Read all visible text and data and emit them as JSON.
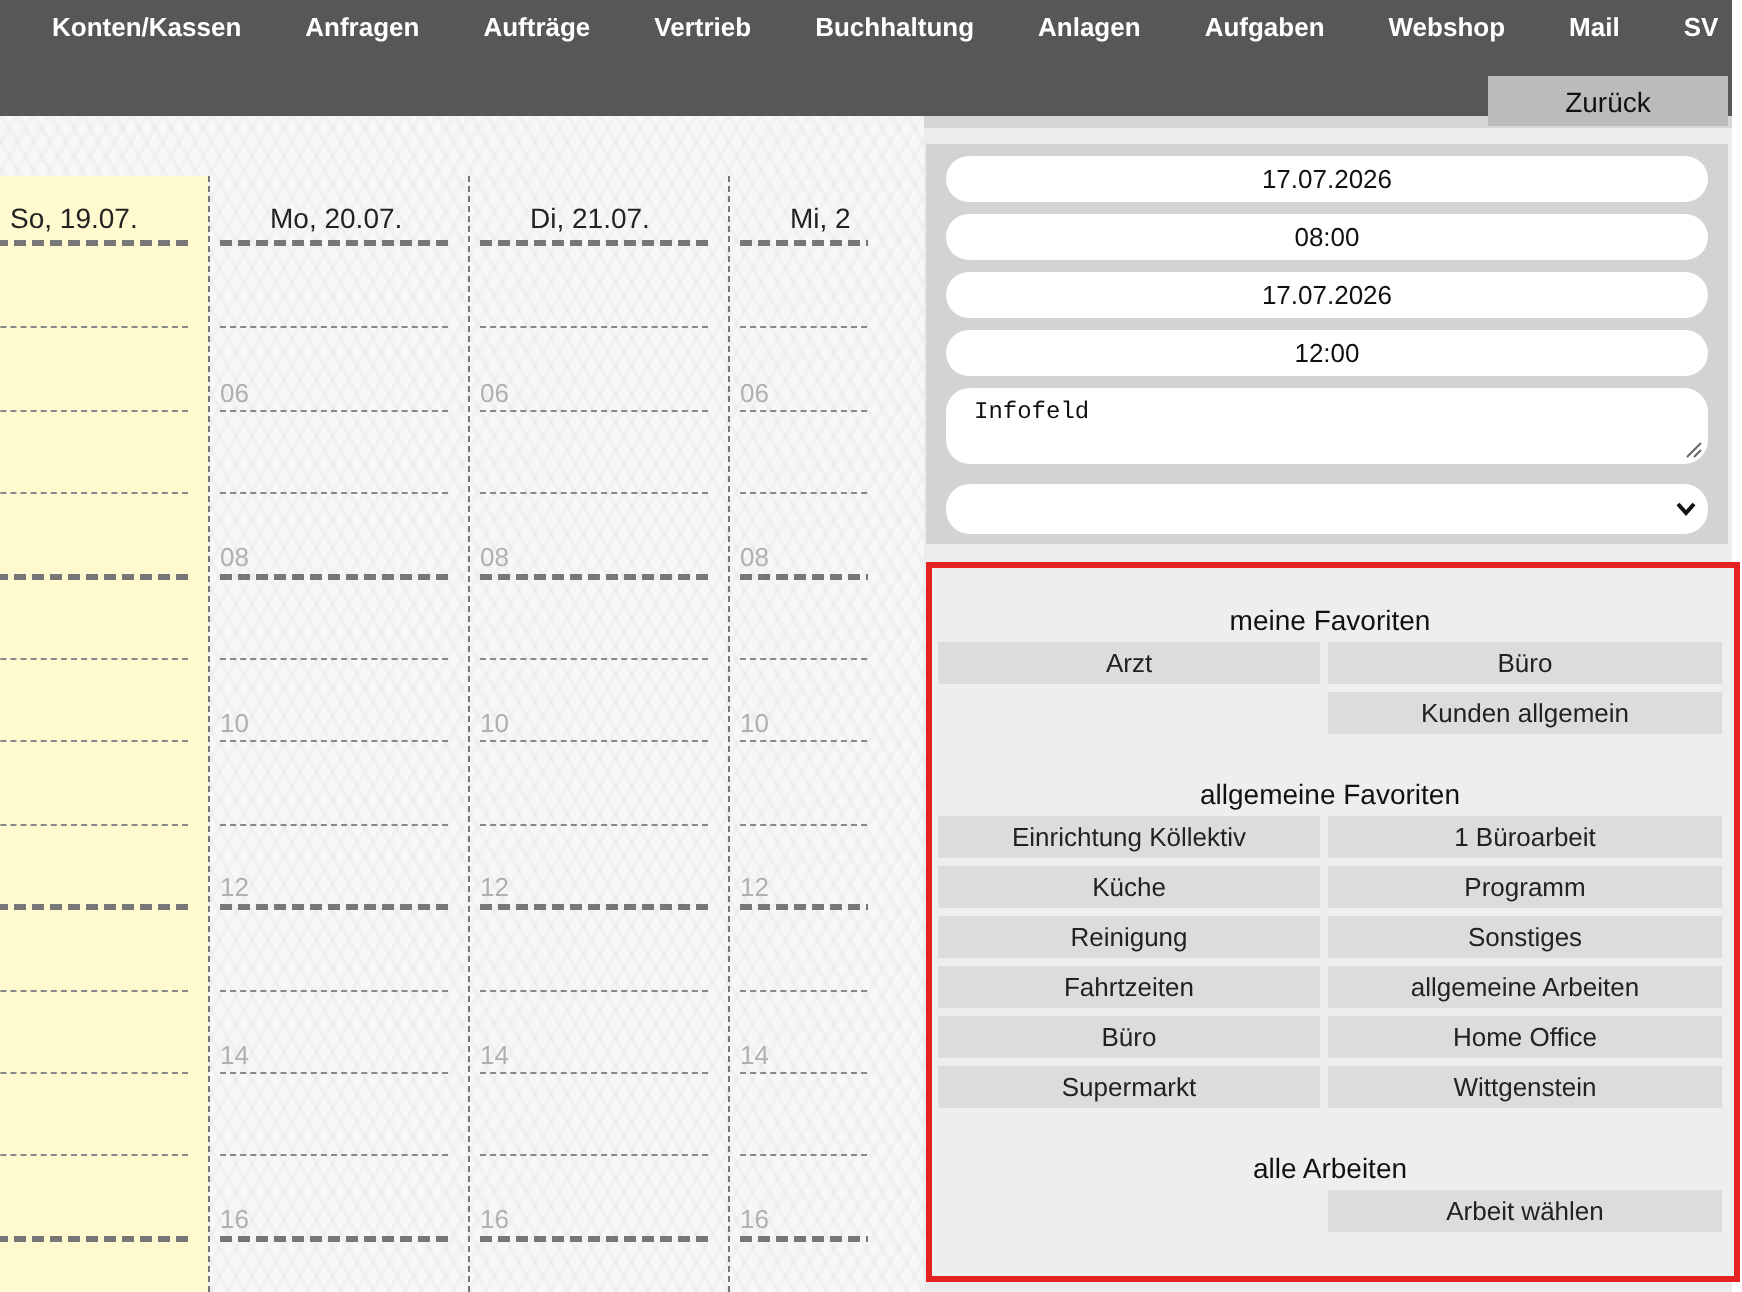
{
  "nav": {
    "items": [
      "Konten/Kassen",
      "Anfragen",
      "Aufträge",
      "Vertrieb",
      "Buchhaltung",
      "Anlagen",
      "Aufgaben",
      "Webshop",
      "Mail",
      "SV"
    ],
    "back_button": "Zurück"
  },
  "calendar": {
    "days": [
      {
        "label": "So, 19.07.",
        "highlighted": true,
        "lines": [
          {
            "major": false
          },
          {
            "major": false
          },
          {
            "major": false
          },
          {
            "major": true
          },
          {
            "major": false
          },
          {
            "major": false
          },
          {
            "major": false
          },
          {
            "major": true
          },
          {
            "major": false
          },
          {
            "major": false
          },
          {
            "major": false
          },
          {
            "major": true
          }
        ]
      },
      {
        "label": "Mo, 20.07.",
        "highlighted": false,
        "lines": [
          {
            "major": false
          },
          {
            "label": "06",
            "major": false
          },
          {
            "major": false
          },
          {
            "label": "08",
            "major": true
          },
          {
            "major": false
          },
          {
            "label": "10",
            "major": false
          },
          {
            "major": false
          },
          {
            "label": "12",
            "major": true
          },
          {
            "major": false
          },
          {
            "label": "14",
            "major": false
          },
          {
            "major": false
          },
          {
            "label": "16",
            "major": true
          }
        ]
      },
      {
        "label": "Di, 21.07.",
        "highlighted": false,
        "lines": [
          {
            "major": false
          },
          {
            "label": "06",
            "major": false
          },
          {
            "major": false
          },
          {
            "label": "08",
            "major": true
          },
          {
            "major": false
          },
          {
            "label": "10",
            "major": false
          },
          {
            "major": false
          },
          {
            "label": "12",
            "major": true
          },
          {
            "major": false
          },
          {
            "label": "14",
            "major": false
          },
          {
            "major": false
          },
          {
            "label": "16",
            "major": true
          }
        ]
      },
      {
        "label": "Mi, 2",
        "highlighted": false,
        "lines": [
          {
            "major": false
          },
          {
            "label": "06",
            "major": false
          },
          {
            "major": false
          },
          {
            "label": "08",
            "major": true
          },
          {
            "major": false
          },
          {
            "label": "10",
            "major": false
          },
          {
            "major": false
          },
          {
            "label": "12",
            "major": true
          },
          {
            "major": false
          },
          {
            "label": "14",
            "major": false
          },
          {
            "major": false
          },
          {
            "label": "16",
            "major": true
          }
        ]
      }
    ]
  },
  "event_form": {
    "fields": [
      {
        "kind": "input",
        "value": "17.07.2026"
      },
      {
        "kind": "input",
        "value": "08:00"
      },
      {
        "kind": "input",
        "value": "17.07.2026"
      },
      {
        "kind": "input",
        "value": "12:00"
      },
      {
        "kind": "textarea",
        "value": "Infofeld"
      },
      {
        "kind": "select"
      }
    ]
  },
  "favorites": {
    "sections": [
      {
        "title": "meine Favoriten",
        "rows": [
          {
            "left": "Arzt",
            "right": "Büro"
          },
          {
            "right": "Kunden allgemein"
          }
        ]
      },
      {
        "title": "allgemeine Favoriten",
        "rows": [
          {
            "left": "Einrichtung Köllektiv",
            "right": "1 Büroarbeit"
          },
          {
            "left": "Küche",
            "right": "Programm"
          },
          {
            "left": "Reinigung",
            "right": "Sonstiges"
          },
          {
            "left": "Fahrtzeiten",
            "right": "allgemeine Arbeiten"
          },
          {
            "left": "Büro",
            "right": "Home Office"
          },
          {
            "left": "Supermarkt",
            "right": "Wittgenstein"
          }
        ]
      },
      {
        "title": "alle Arbeiten",
        "rows": [
          {
            "right": "Arbeit wählen"
          }
        ]
      }
    ]
  }
}
